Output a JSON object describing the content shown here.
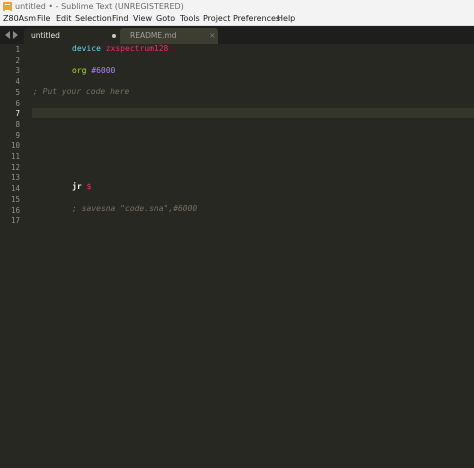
{
  "window": {
    "title": "untitled • - Sublime Text (UNREGISTERED)"
  },
  "menu": {
    "items": [
      "Z80Asm",
      "File",
      "Edit",
      "Selection",
      "Find",
      "View",
      "Goto",
      "Tools",
      "Project",
      "Preferences",
      "Help"
    ]
  },
  "tabs": [
    {
      "label": "untitled",
      "active": true,
      "dirty": true
    },
    {
      "label": "README.md",
      "active": false
    }
  ],
  "editor": {
    "active_line": 7,
    "line_numbers": [
      "1",
      "2",
      "3",
      "4",
      "5",
      "6",
      "7",
      "8",
      "9",
      "10",
      "11",
      "12",
      "13",
      "14",
      "15",
      "16",
      "17"
    ],
    "lines": {
      "l1_kw": "device",
      "l1_arg": "zxspectrum128",
      "l3_kw": "org",
      "l3_arg": "#6000",
      "l5_comment": "; Put your code here",
      "l14_op": "jr",
      "l14_arg": "$",
      "l16_comment": "; savesna \"code.sna\",#6000"
    }
  },
  "colors": {
    "background": "#272822",
    "keyword": "#66d9ef",
    "string": "#f92672",
    "org": "#a6e22e",
    "comment": "#75715e"
  }
}
